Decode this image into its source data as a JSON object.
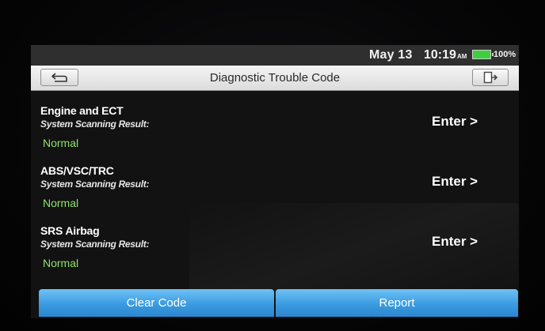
{
  "status_bar": {
    "date": "May 13",
    "time": "10:19",
    "ampm": "AM",
    "battery": "100%",
    "battery_color": "#3ecf3e"
  },
  "header": {
    "title": "Diagnostic Trouble Code",
    "back_icon": "back-arrow-icon",
    "exit_icon": "exit-door-icon"
  },
  "systems": [
    {
      "name": "Engine and ECT",
      "subtitle": "System Scanning Result:",
      "status": "Normal",
      "action": "Enter >"
    },
    {
      "name": "ABS/VSC/TRC",
      "subtitle": "System Scanning Result:",
      "status": "Normal",
      "action": "Enter >"
    },
    {
      "name": "SRS Airbag",
      "subtitle": "System Scanning Result:",
      "status": "Normal",
      "action": "Enter >"
    }
  ],
  "footer": {
    "clear_label": "Clear Code",
    "report_label": "Report"
  },
  "colors": {
    "status_ok": "#8fe36a",
    "button_blue": "#3a9be0"
  }
}
